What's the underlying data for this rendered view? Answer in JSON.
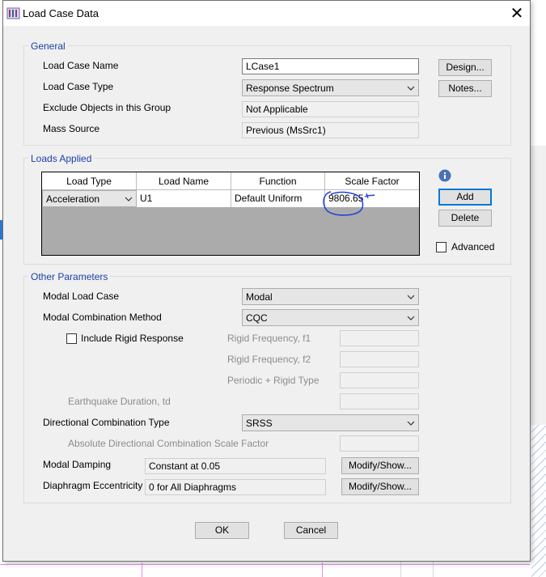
{
  "window": {
    "title": "Load Case Data",
    "close_glyph": "✕",
    "icon": "app-icon"
  },
  "general": {
    "heading": "General",
    "load_case_name_label": "Load Case Name",
    "load_case_name_value": "LCase1",
    "load_case_type_label": "Load Case Type",
    "load_case_type_value": "Response Spectrum",
    "exclude_label": "Exclude Objects in this Group",
    "exclude_value": "Not Applicable",
    "mass_source_label": "Mass Source",
    "mass_source_value": "Previous  (MsSrc1)",
    "design_button": "Design...",
    "notes_button": "Notes..."
  },
  "loads_applied": {
    "heading": "Loads Applied",
    "columns": [
      "Load Type",
      "Load Name",
      "Function",
      "Scale Factor"
    ],
    "rows": [
      {
        "load_type": "Acceleration",
        "load_name": "U1",
        "function": "Default Uniform",
        "scale_factor": "9806.65"
      }
    ],
    "add_button": "Add",
    "delete_button": "Delete",
    "advanced_label": "Advanced",
    "advanced_checked": false,
    "annotation_color": "#1f3fe0"
  },
  "other": {
    "heading": "Other Parameters",
    "modal_load_case_label": "Modal Load Case",
    "modal_load_case_value": "Modal",
    "modal_combination_label": "Modal Combination Method",
    "modal_combination_value": "CQC",
    "include_rigid_label": "Include Rigid Response",
    "include_rigid_checked": false,
    "rigid_f1_label": "Rigid Frequency, f1",
    "rigid_f2_label": "Rigid Frequency, f2",
    "periodic_label": "Periodic + Rigid Type",
    "eq_duration_label": "Earthquake Duration, td",
    "directional_label": "Directional Combination Type",
    "directional_value": "SRSS",
    "abs_scale_label": "Absolute Directional Combination Scale Factor",
    "modal_damping_label": "Modal Damping",
    "modal_damping_value": "Constant at 0.05",
    "diaphragm_label": "Diaphragm Eccentricity",
    "diaphragm_value": "0 for All Diaphragms",
    "modify_show_button": "Modify/Show...",
    "modify_show_button_2": "Modify/Show..."
  },
  "footer": {
    "ok_button": "OK",
    "cancel_button": "Cancel"
  }
}
